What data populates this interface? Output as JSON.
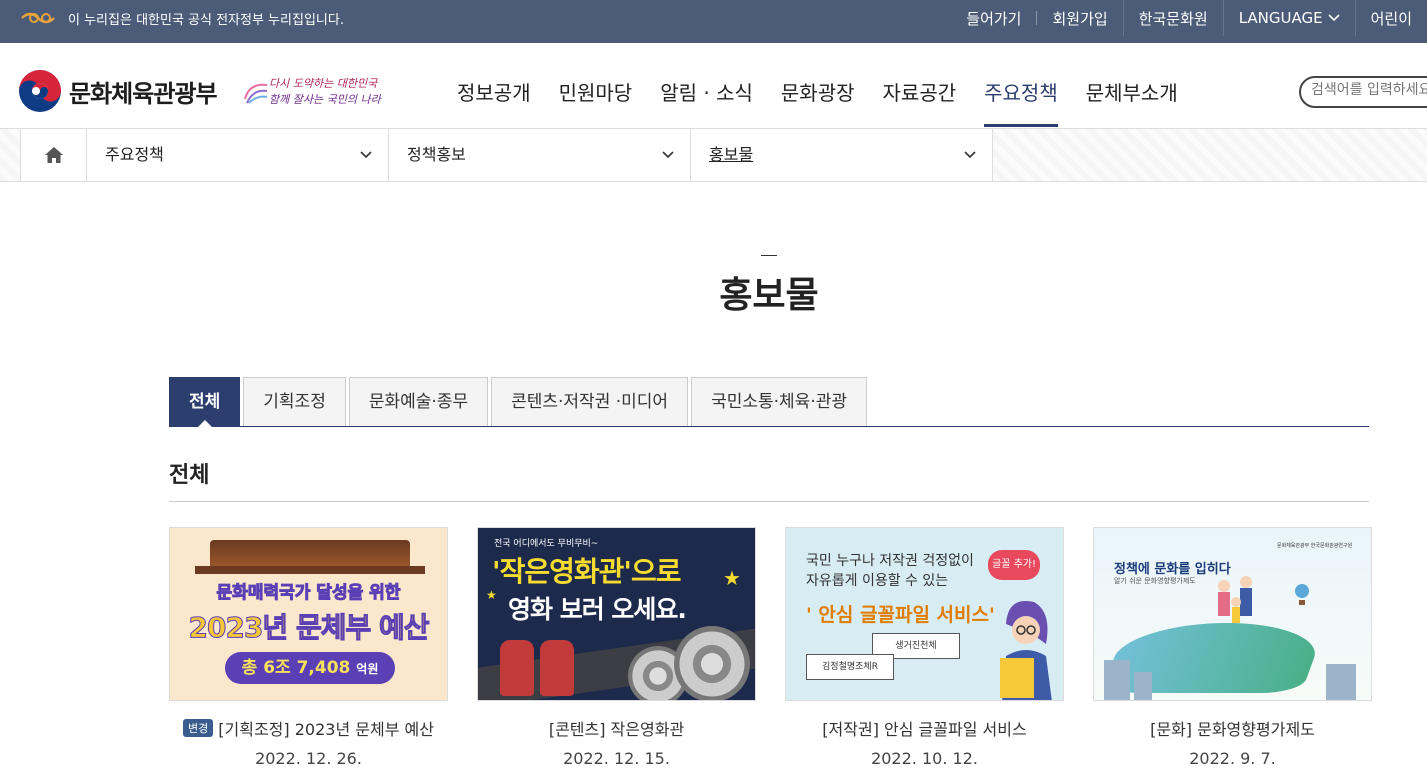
{
  "gov_bar": {
    "notice": "이 누리집은 대한민국 공식 전자정부 누리집입니다.",
    "links": [
      "들어가기",
      "회원가입",
      "한국문화원",
      "LANGUAGE",
      "어린이"
    ]
  },
  "header": {
    "logo_text": "문화체육관광부",
    "slogan_line1": "다시 도약하는 대한민국",
    "slogan_line2": "함께 잘사는 국민의 나라",
    "gnb": [
      "정보공개",
      "민원마당",
      "알림 · 소식",
      "문화광장",
      "자료공간",
      "주요정책",
      "문체부소개"
    ],
    "gnb_active": "주요정책",
    "search_placeholder": "검색어를 입력하세요"
  },
  "breadcrumb": {
    "items": [
      "주요정책",
      "정책홍보",
      "홍보물"
    ]
  },
  "page_title": "홍보물",
  "tabs": {
    "items": [
      "전체",
      "기획조정",
      "문화예술·종무",
      "콘텐츠·저작권 ·미디어",
      "국민소통·체육·관광"
    ],
    "active": "전체"
  },
  "section_title": "전체",
  "cards": [
    {
      "badge": "변경",
      "title": "[기획조정] 2023년 문체부 예산",
      "date": "2022. 12. 26.",
      "thumb": {
        "line1": "문화매력국가 달성을 위한",
        "line2": "2023년 문체부 예산",
        "pill_prefix": "총",
        "pill_value": "6조 7,408",
        "pill_unit": "억원"
      }
    },
    {
      "badge": "",
      "title": "[콘텐츠] 작은영화관",
      "date": "2022. 12. 15.",
      "thumb": {
        "sub": "전국 어디에서도 무비무비~",
        "line1": "'작은영화관'으로",
        "line2": "영화 보러 오세요."
      }
    },
    {
      "badge": "",
      "title": "[저작권] 안심 글꼴파일 서비스",
      "date": "2022. 10. 12.",
      "thumb": {
        "line1": "국민 누구나 저작권 걱정없이",
        "line2": "자유롭게 이용할 수 있는",
        "line3": "' 안심 글꼴파일 서비스'",
        "bubble": "글꼴 추가!",
        "box1": "생거진천체",
        "box2": "김정철명조체R"
      }
    },
    {
      "badge": "",
      "title": "[문화] 문화영향평가제도",
      "date": "2022. 9. 7.",
      "thumb": {
        "line1": "정책에 문화를 입히다",
        "line2": "알기 쉬운 문화영향평가제도",
        "logos": "문화체육관광부   한국문화관광연구원"
      }
    }
  ],
  "colors": {
    "gov_bar": "#4c5c78",
    "accent": "#2c3e6e",
    "badge": "#3b5c8e"
  }
}
